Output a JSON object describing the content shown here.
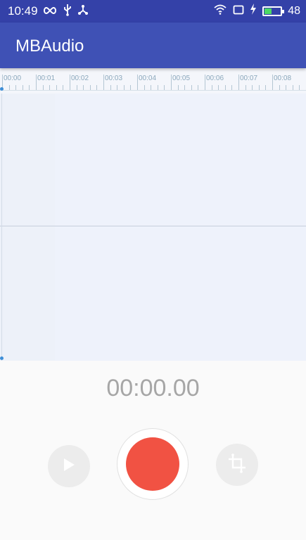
{
  "status_bar": {
    "time": "10:49",
    "battery_level": "48",
    "battery_fraction": 0.48,
    "icons": [
      "infinity-icon",
      "usb-icon",
      "share-icon",
      "wifi-icon",
      "cast-icon",
      "charging-icon",
      "battery-icon"
    ]
  },
  "app_bar": {
    "title": "MBAudio"
  },
  "timeline": {
    "labels": [
      "00:00",
      "00:01",
      "00:02",
      "00:03",
      "00:04",
      "00:05",
      "00:06",
      "00:07",
      "00:08"
    ]
  },
  "recorder": {
    "elapsed": "00:00.00",
    "record_color": "#f15243"
  },
  "colors": {
    "status_bar": "#3441a8",
    "app_bar": "#3f51b5",
    "waveform_bg": "#eef2fb",
    "accent_marker": "#3d8ed7"
  }
}
